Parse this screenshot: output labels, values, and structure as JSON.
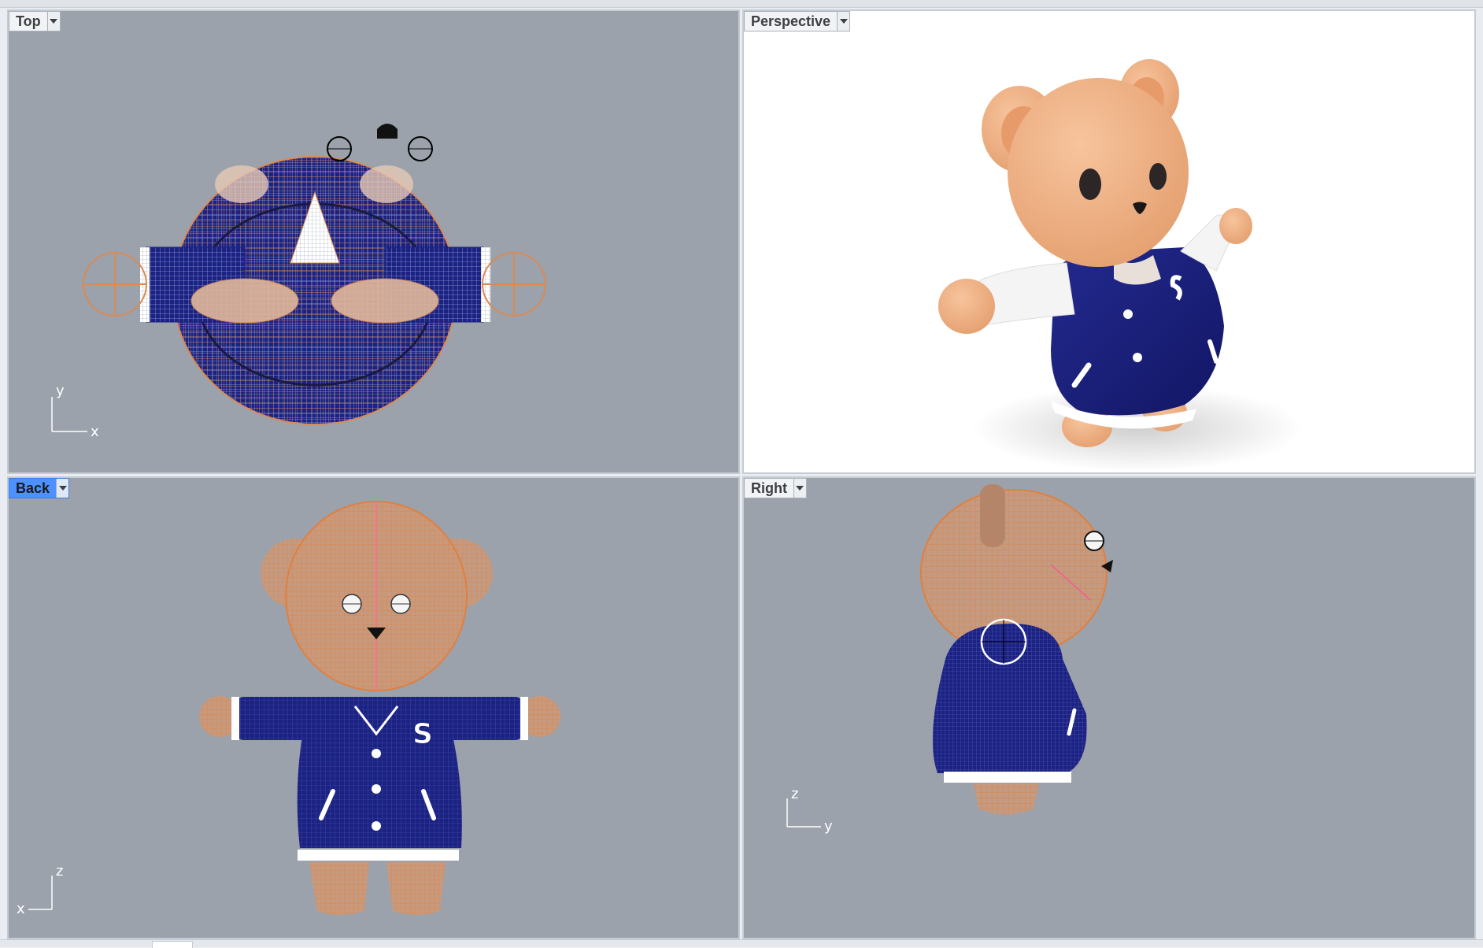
{
  "viewports": {
    "top": {
      "label": "Top",
      "axis_h": "x",
      "axis_v": "y"
    },
    "perspective": {
      "label": "Perspective"
    },
    "back": {
      "label": "Back",
      "axis_h": "x",
      "axis_v": "z",
      "active": true
    },
    "right": {
      "label": "Right",
      "axis_h": "y",
      "axis_v": "z"
    }
  },
  "colors": {
    "viewport_bg": "#9ba2ab",
    "active_tab": "#4d90fe",
    "wire_orange": "#d98a55",
    "jacket_navy": "#1a1f7a",
    "bear_skin": "#f2b384"
  },
  "icons": {
    "tab_dropdown": "chevron-down-icon",
    "axis_gizmo": "axis-icon"
  }
}
